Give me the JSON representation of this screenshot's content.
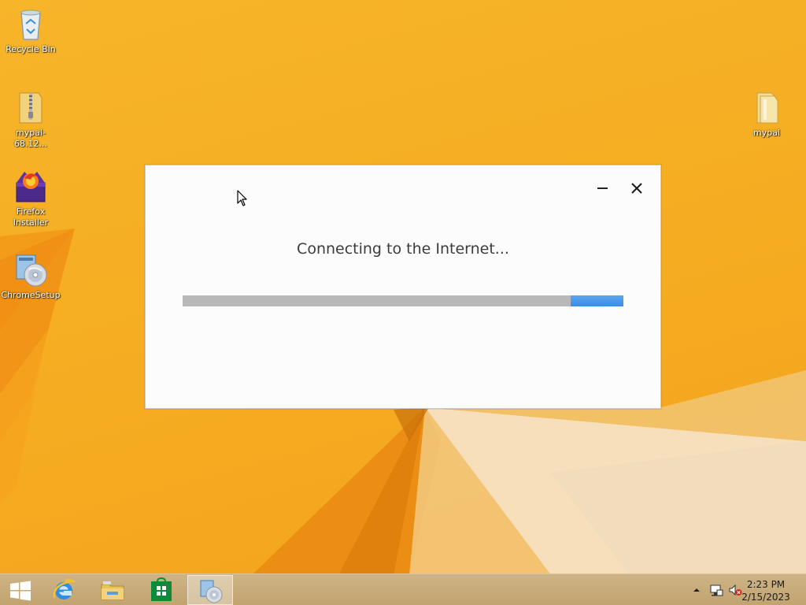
{
  "desktop": {
    "icons": [
      {
        "label": "Recycle Bin"
      },
      {
        "label": "mypal-68.12..."
      },
      {
        "label": "Firefox Installer"
      },
      {
        "label": "ChromeSetup"
      },
      {
        "label": "mypal"
      }
    ]
  },
  "dialog": {
    "status_text": "Connecting to the Internet...",
    "progress_mode": "indeterminate"
  },
  "taskbar": {
    "buttons": [
      "start-icon",
      "internet-explorer-icon",
      "file-explorer-icon",
      "store-icon",
      "chrome-setup-icon"
    ],
    "clock": {
      "time": "2:23 PM",
      "date": "2/15/2023"
    }
  },
  "colors": {
    "wallpaper": "#f6ad22",
    "progress_fill": "#3d8ce6",
    "progress_track": "#b8b8b8"
  }
}
